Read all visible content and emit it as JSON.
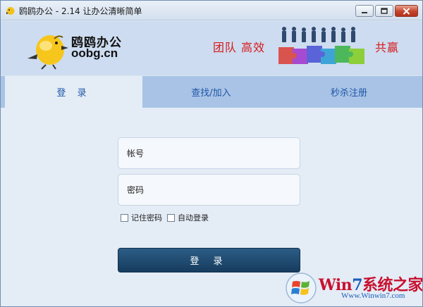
{
  "window": {
    "title": "鸥鸥办公 - 2.14 让办公清晰简单"
  },
  "banner": {
    "logo_cn": "鸥鸥办公",
    "logo_en": "oobg.cn",
    "slogan_left": "团队  高效",
    "slogan_right": "共赢"
  },
  "tabs": [
    {
      "label": "登 录",
      "active": true
    },
    {
      "label": "查找/加入",
      "active": false
    },
    {
      "label": "秒杀注册",
      "active": false
    }
  ],
  "form": {
    "username_placeholder": "帐号",
    "password_placeholder": "密码",
    "remember_label": "记住密码",
    "remember_checked": false,
    "autologin_label": "自动登录",
    "autologin_checked": false,
    "login_label": "登 录"
  },
  "watermark": {
    "brand_prefix": "Win",
    "brand_digit": "7",
    "brand_cn": "系统之家",
    "url": "Www.Winwin7.com"
  },
  "colors": {
    "accent": "#1e57a6",
    "slogan": "#d61a1a",
    "button": "#1f4a72"
  }
}
